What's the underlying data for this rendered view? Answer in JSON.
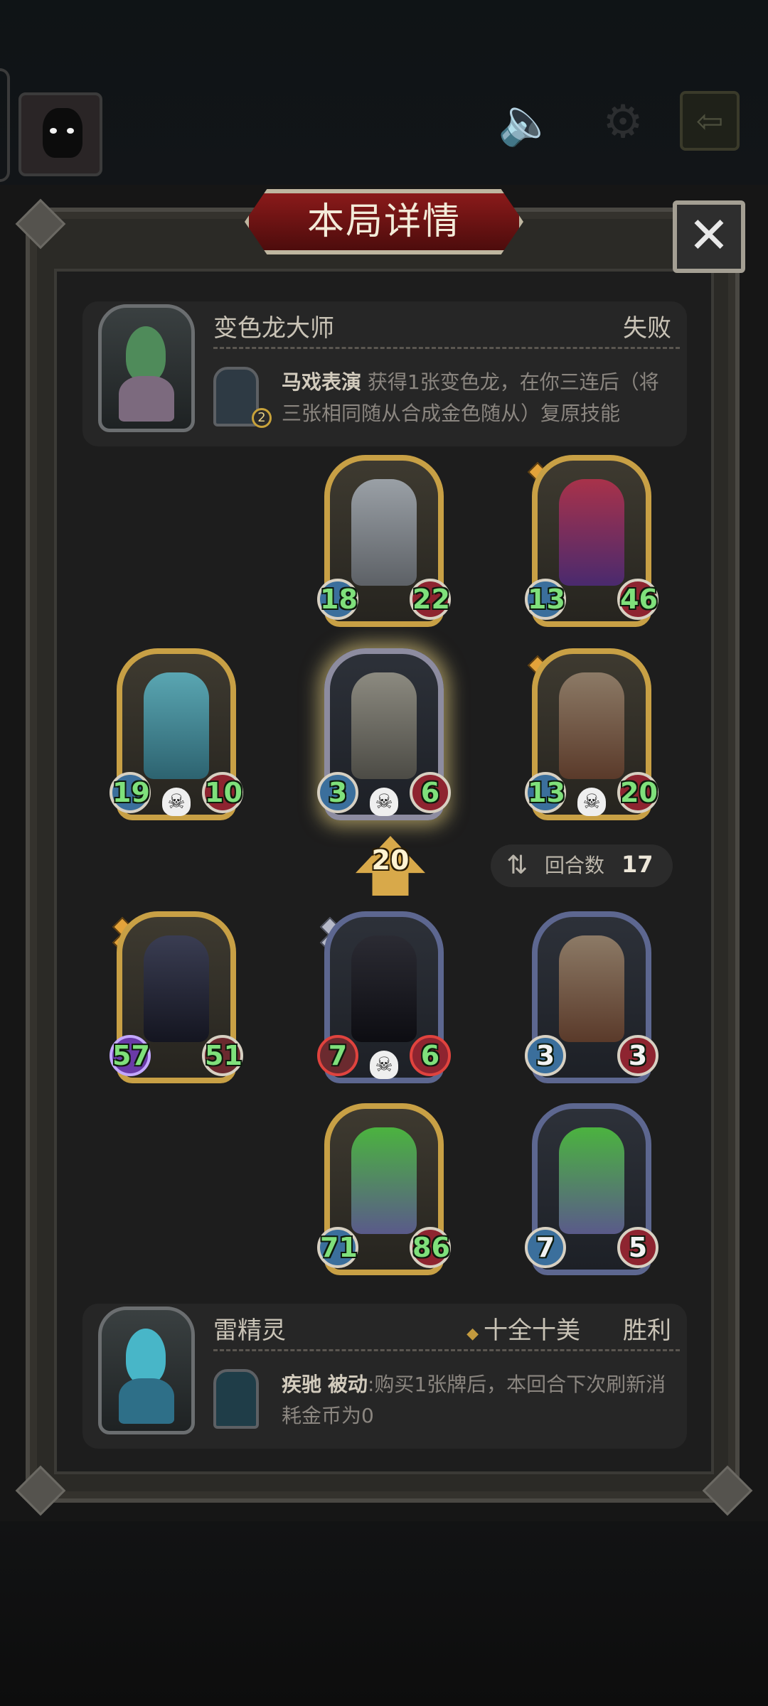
{
  "title": "本局详情",
  "close_label": "✕",
  "opponent": {
    "name": "变色龙大师",
    "result": "失败",
    "skill_level": "2",
    "skill_name": "马戏表演",
    "skill_desc": " 获得1张变色龙，在你三连后（将三张相同随从合成金色随从）复原技能"
  },
  "opponent_units": [
    {
      "attack": "18",
      "health": "22"
    },
    {
      "attack": "13",
      "health": "46"
    },
    {
      "attack": "19",
      "health": "10"
    },
    {
      "attack": "3",
      "health": "6"
    },
    {
      "attack": "13",
      "health": "20"
    }
  ],
  "tavern_tier": "20",
  "round": {
    "label": "回合数",
    "value": "17"
  },
  "player_units": [
    {
      "attack": "57",
      "health": "51"
    },
    {
      "attack": "7",
      "health": "6"
    },
    {
      "attack": "3",
      "health": "3"
    },
    {
      "attack": "71",
      "health": "86"
    },
    {
      "attack": "7",
      "health": "5"
    }
  ],
  "player": {
    "name": "雷精灵",
    "tag": "十全十美",
    "result": "胜利",
    "skill_name": "疾驰",
    "skill_type": "被动",
    "skill_desc": ":购买1张牌后，本回合下次刷新消耗金币为0"
  },
  "icons": [
    "speaker-icon",
    "gear-icon",
    "exit-icon",
    "close-icon",
    "skull-icon",
    "round-swap-icon",
    "tier-up-icon"
  ],
  "colors": {
    "gold_frame": "#c8a045",
    "silver_frame": "#5d6790",
    "title_red": "#8a1a1a",
    "stat_green": "#7fe07b"
  }
}
